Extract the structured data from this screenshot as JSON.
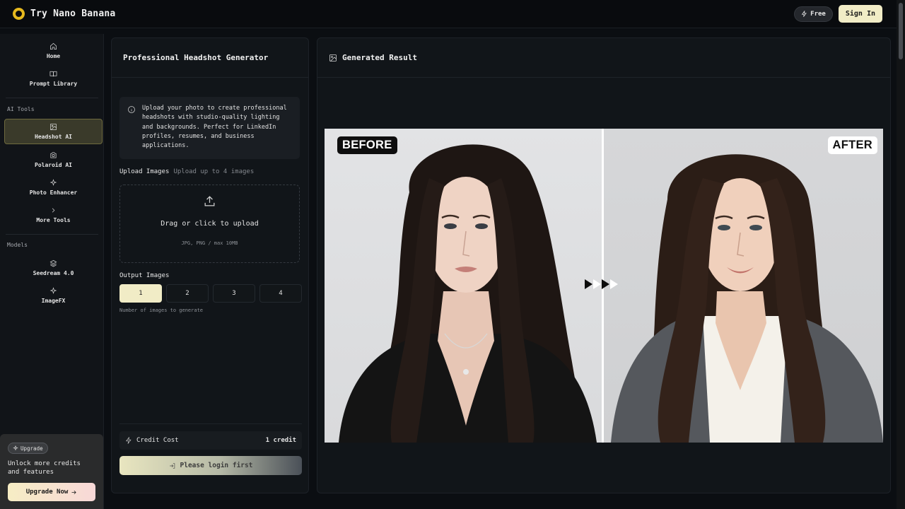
{
  "app": {
    "title": "Try Nano Banana"
  },
  "topbar": {
    "free_label": "Free",
    "signin_label": "Sign In"
  },
  "sidebar": {
    "nav": [
      {
        "label": "Home",
        "icon": "home-icon"
      },
      {
        "label": "Prompt Library",
        "icon": "book-icon"
      }
    ],
    "ai_tools_heading": "AI Tools",
    "ai_tools": [
      {
        "label": "Headshot AI",
        "icon": "image-icon",
        "active": true
      },
      {
        "label": "Polaroid AI",
        "icon": "camera-icon"
      },
      {
        "label": "Photo Enhancer",
        "icon": "sparkle-icon"
      },
      {
        "label": "More Tools",
        "icon": "chevron-right-icon"
      }
    ],
    "models_heading": "Models",
    "models": [
      {
        "label": "Seedream 4.0",
        "icon": "layers-icon"
      },
      {
        "label": "ImageFX",
        "icon": "sparkle-icon"
      }
    ],
    "upgrade": {
      "chip_label": "Upgrade",
      "text": "Unlock more credits and features",
      "button_label": "Upgrade Now"
    }
  },
  "generator": {
    "title": "Professional Headshot Generator",
    "info": "Upload your photo to create professional headshots with studio-quality lighting and backgrounds. Perfect for LinkedIn profiles, resumes, and business applications.",
    "upload_label": "Upload Images",
    "upload_hint": "Upload up to 4 images",
    "drop_text": "Drag or click to upload",
    "drop_formats": "JPG, PNG / max 10MB",
    "output_label": "Output Images",
    "output_options": [
      "1",
      "2",
      "3",
      "4"
    ],
    "output_selected": "1",
    "output_hint": "Number of images to generate",
    "credit_label": "Credit Cost",
    "credit_value": "1 credit",
    "login_label": "Please login first"
  },
  "result": {
    "title": "Generated Result",
    "before_label": "BEFORE",
    "after_label": "AFTER"
  },
  "colors": {
    "accent": "#f1ecc6",
    "background": "#0b0e12",
    "panel": "#111519",
    "active_nav": "#3a3a2a"
  }
}
